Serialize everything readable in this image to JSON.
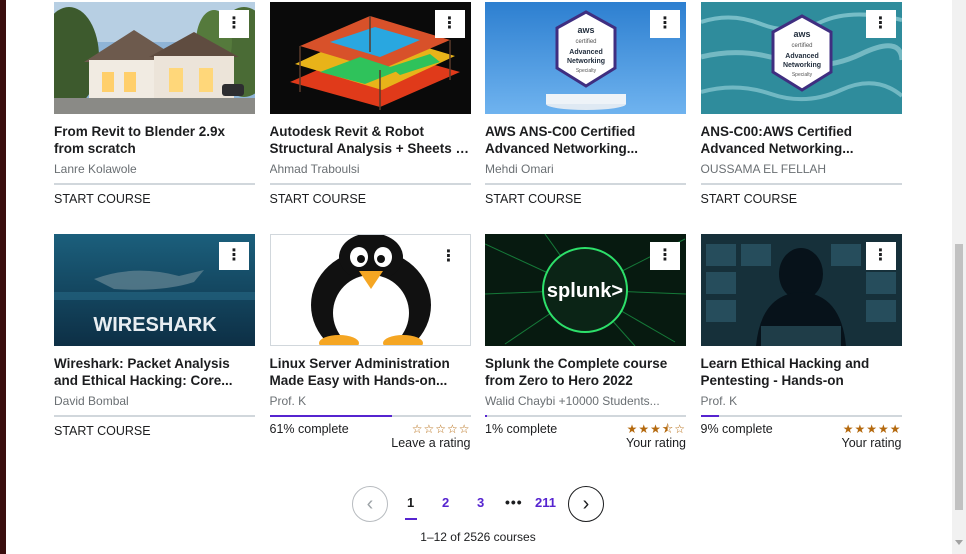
{
  "courses": [
    {
      "title": "From Revit to Blender 2.9x from scratch",
      "author": "Lanre Kolawole",
      "action": "START COURSE",
      "thumb_icon": "house-render-thumbnail"
    },
    {
      "title": "Autodesk Revit & Robot Structural Analysis + Sheets + ...",
      "author": "Ahmad Traboulsi",
      "action": "START COURSE",
      "thumb_icon": "structural-analysis-thumbnail"
    },
    {
      "title": "AWS ANS-C00 Certified Advanced Networking...",
      "author": "Mehdi Omari",
      "action": "START COURSE",
      "thumb_icon": "aws-badge-thumbnail"
    },
    {
      "title": "ANS-C00:AWS Certified Advanced Networking...",
      "author": "OUSSAMA EL FELLAH",
      "action": "START COURSE",
      "thumb_icon": "aws-badge-ocean-thumbnail"
    },
    {
      "title": "Wireshark: Packet Analysis and Ethical Hacking: Core...",
      "author": "David Bombal",
      "action": "START COURSE",
      "thumb_icon": "wireshark-thumbnail"
    },
    {
      "title": "Linux Server Administration Made Easy with Hands-on...",
      "author": "Prof. K",
      "progress_text": "61% complete",
      "progress": 0.61,
      "stars": "☆☆☆☆☆",
      "rating": 0,
      "rating_label": "Leave a rating",
      "thumb_icon": "linux-penguin-thumbnail"
    },
    {
      "title": "Splunk the Complete course from Zero to Hero 2022",
      "author": "Walid Chaybi +10000 Students...",
      "progress_text": "1% complete",
      "progress": 0.01,
      "stars": "★★★⯪☆",
      "rating": 3.5,
      "rating_label": "Your rating",
      "thumb_icon": "splunk-thumbnail"
    },
    {
      "title": "Learn Ethical Hacking and Pentesting - Hands-on",
      "author": "Prof. K",
      "progress_text": "9% complete",
      "progress": 0.09,
      "stars": "★★★★★",
      "rating": 5,
      "rating_label": "Your rating",
      "thumb_icon": "hacker-thumbnail"
    }
  ],
  "thumb_text": {
    "aws_top": "aws",
    "aws_certified": "certified",
    "aws_line1": "Advanced",
    "aws_line2": "Networking",
    "aws_specialty": "Specialty",
    "wireshark": "WIRESHARK",
    "splunk": "splunk>"
  },
  "card_menu_glyph": "⋮",
  "pagination": {
    "prev_icon": "‹",
    "next_icon": "›",
    "pages": [
      "1",
      "2",
      "3"
    ],
    "ellipsis": "•••",
    "last": "211",
    "current": "1"
  },
  "result_count": "1–12 of 2526 courses",
  "colors": {
    "accent": "#5624d0",
    "star": "#b4690e",
    "text": "#1c1d1f",
    "muted": "#6a6f73"
  }
}
